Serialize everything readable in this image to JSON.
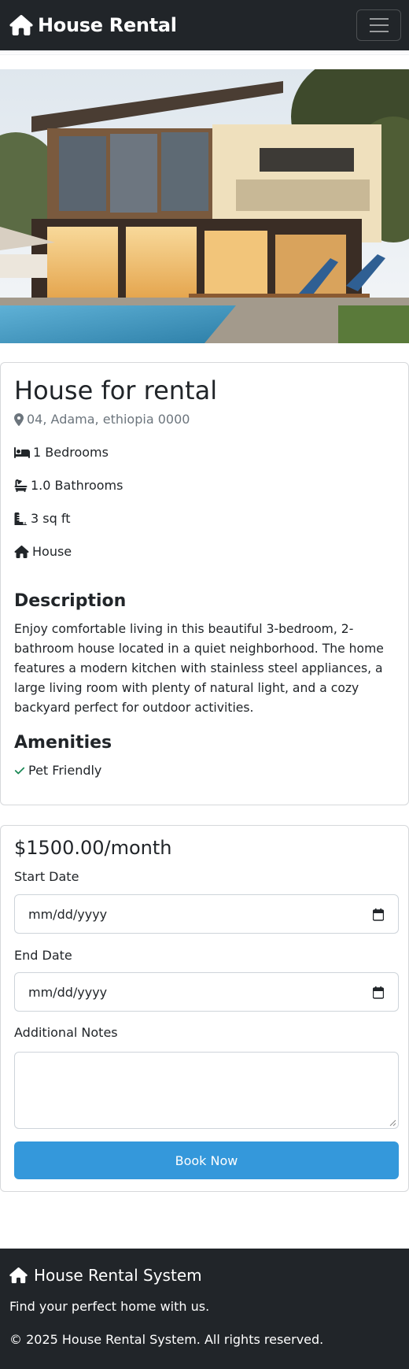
{
  "navbar": {
    "brand": "House Rental",
    "brand_icon": "home-icon",
    "menu_icon": "hamburger-menu-icon"
  },
  "property": {
    "title": "House for rental",
    "location": "04, Adama, ethiopia 0000",
    "bedrooms": "1 Bedrooms",
    "bathrooms": "1.0 Bathrooms",
    "area": "3 sq ft",
    "type": "House",
    "description_title": "Description",
    "description": "Enjoy comfortable living in this beautiful 3-bedroom, 2-bathroom house located in a quiet neighborhood. The home features a modern kitchen with stainless steel appliances, a large living room with plenty of natural light, and a cozy backyard perfect for outdoor activities.",
    "amenities_title": "Amenities",
    "amenities": [
      "Pet Friendly"
    ]
  },
  "booking": {
    "price": "$1500.00/month",
    "start_label": "Start Date",
    "start_value": "mm/dd/yyyy",
    "end_label": "End Date",
    "end_value": "mm/dd/yyyy",
    "notes_label": "Additional Notes",
    "button": "Book Now"
  },
  "footer": {
    "brand": "House Rental System",
    "tagline": "Find your perfect home with us.",
    "copyright": "© 2025 House Rental System. All rights reserved."
  },
  "colors": {
    "navbar": "#212529",
    "accent": "#3498db",
    "check": "#198754"
  }
}
